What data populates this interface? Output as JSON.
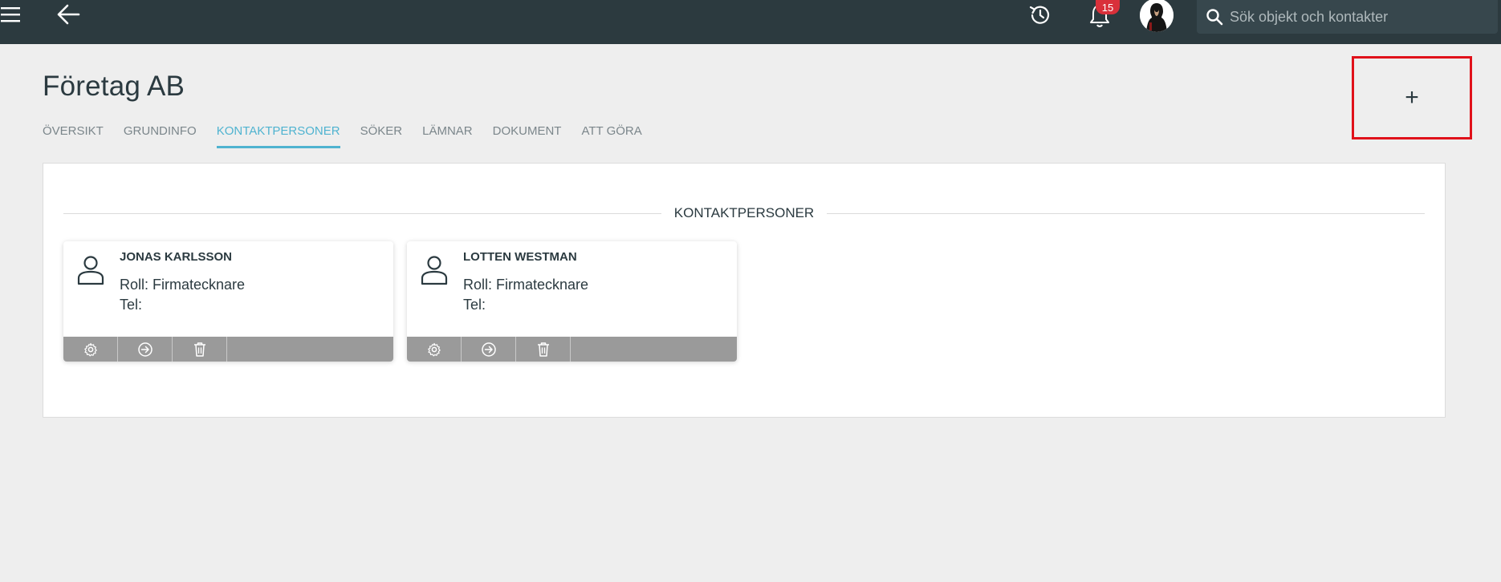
{
  "header": {
    "search_placeholder": "Sök objekt och kontakter",
    "notification_count": "15",
    "icons": [
      "menu-icon",
      "back-arrow-icon",
      "history-icon",
      "bell-icon",
      "search-icon"
    ]
  },
  "page": {
    "title": "Företag AB",
    "tabs": [
      {
        "label": "ÖVERSIKT",
        "active": false
      },
      {
        "label": "GRUNDINFO",
        "active": false
      },
      {
        "label": "KONTAKTPERSONER",
        "active": true
      },
      {
        "label": "SÖKER",
        "active": false
      },
      {
        "label": "LÄMNAR",
        "active": false
      },
      {
        "label": "DOKUMENT",
        "active": false
      },
      {
        "label": "ATT GÖRA",
        "active": false
      }
    ],
    "add_label": "+"
  },
  "section": {
    "heading": "KONTAKTPERSONER"
  },
  "contacts": [
    {
      "name": "JONAS KARLSSON",
      "role": "Roll: Firmatecknare",
      "tel": "Tel:"
    },
    {
      "name": "LOTTEN WESTMAN",
      "role": "Roll: Firmatecknare",
      "tel": "Tel:"
    }
  ],
  "colors": {
    "topbar": "#2c3a3f",
    "accent": "#4fb3d0",
    "badge": "#d9303a",
    "highlight_box": "#e0111a",
    "card_actions": "#9a9a9a"
  }
}
